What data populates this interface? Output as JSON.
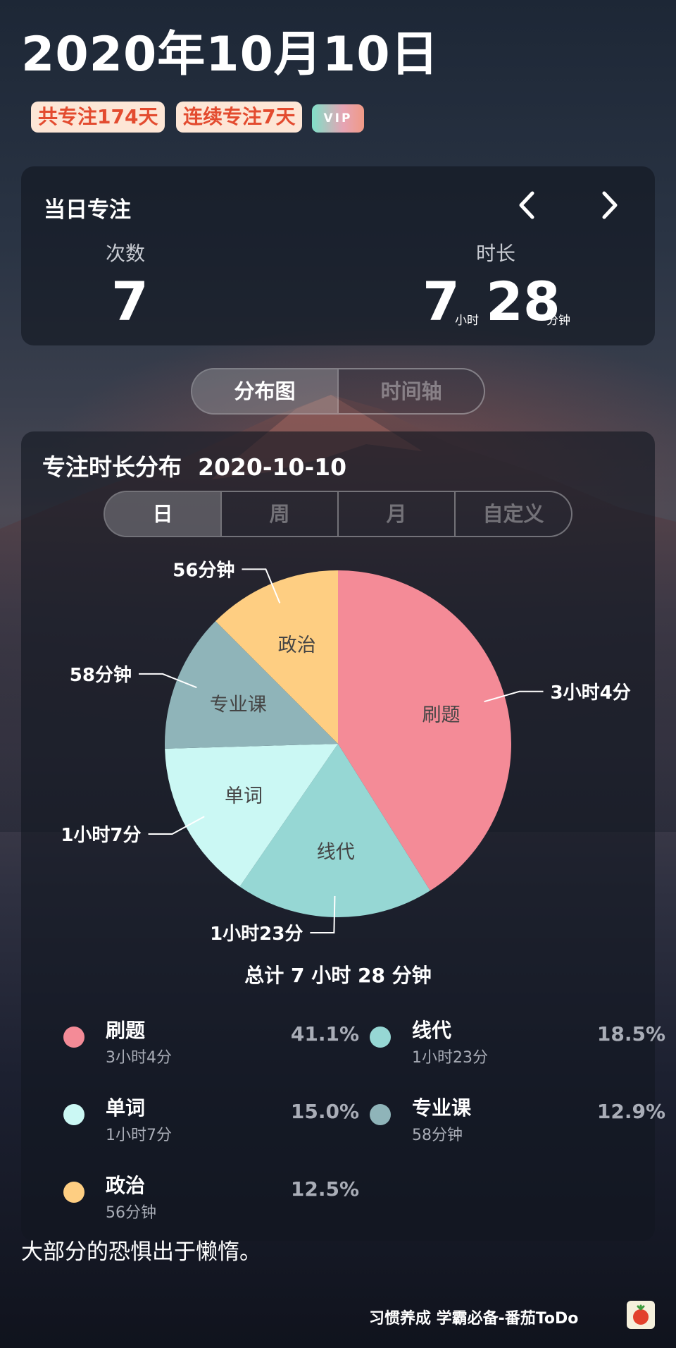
{
  "header": {
    "date": "2020年10月10日",
    "total_focus_badge": "共专注174天",
    "streak_badge": "连续专注7天",
    "vip_label": "VIP"
  },
  "daily_focus": {
    "title": "当日专注",
    "count_label": "次数",
    "count_value": "7",
    "duration_label": "时长",
    "hours_value": "7",
    "hours_unit": "小时",
    "minutes_value": "28",
    "minutes_unit": "分钟"
  },
  "view_tabs": [
    "分布图",
    "时间轴"
  ],
  "distribution": {
    "title": "专注时长分布",
    "date": "2020-10-10",
    "range_tabs": [
      "日",
      "周",
      "月",
      "自定义"
    ],
    "total_label": "总计 7 小时 28 分钟"
  },
  "chart_data": {
    "type": "pie",
    "unit": "minutes",
    "slices": [
      {
        "name": "刷题",
        "minutes": 184,
        "duration_label": "3小时4分",
        "percent": "41.1%",
        "color": "#f48b97"
      },
      {
        "name": "线代",
        "minutes": 83,
        "duration_label": "1小时23分",
        "percent": "18.5%",
        "color": "#96d7d4"
      },
      {
        "name": "单词",
        "minutes": 67,
        "duration_label": "1小时7分",
        "percent": "15.0%",
        "color": "#cbf8f4"
      },
      {
        "name": "专业课",
        "minutes": 58,
        "duration_label": "58分钟",
        "percent": "12.9%",
        "color": "#8fb4b9"
      },
      {
        "name": "政治",
        "minutes": 56,
        "duration_label": "56分钟",
        "percent": "12.5%",
        "color": "#fece82"
      }
    ]
  },
  "quote": "大部分的恐惧出于懒惰。",
  "footer": {
    "brand": "习惯养成 学霸必备-番茄ToDo",
    "app_icon": "tomato-icon"
  },
  "colors": {
    "badge_text": "#e34b2f",
    "badge_bg": "#fde6d6",
    "vip_gradient": [
      "#7fe0c8",
      "#f09a86"
    ]
  }
}
